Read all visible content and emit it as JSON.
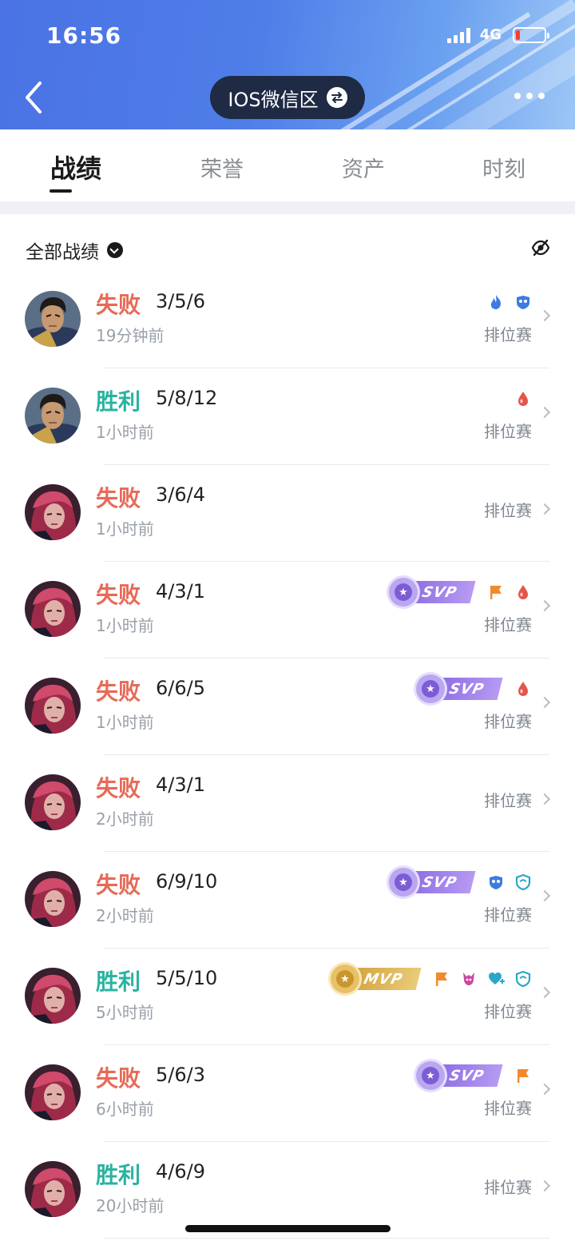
{
  "status_bar": {
    "time": "16:56",
    "network": "4G"
  },
  "header": {
    "server_label": "IOS微信区"
  },
  "tabs": [
    {
      "label": "战绩",
      "active": true
    },
    {
      "label": "荣誉",
      "active": false
    },
    {
      "label": "资产",
      "active": false
    },
    {
      "label": "时刻",
      "active": false
    }
  ],
  "filter": {
    "label": "全部战绩"
  },
  "colors": {
    "header_blue": "#4a72e4",
    "win": "#2bb3a1",
    "loss": "#e76a57",
    "svp_purple": "#8c6be2",
    "mvp_gold": "#d2a23e"
  },
  "matches": [
    {
      "result": "失败",
      "outcome": "loss",
      "kda": "3/5/6",
      "time": "19分钟前",
      "mode": "排位赛",
      "hero": "male-warrior-portrait",
      "rank_badge": null,
      "badges": [
        "flame-icon",
        "mask-icon"
      ]
    },
    {
      "result": "胜利",
      "outcome": "win",
      "kda": "5/8/12",
      "time": "1小时前",
      "mode": "排位赛",
      "hero": "male-warrior-portrait",
      "rank_badge": null,
      "badges": [
        "blood-drop-icon"
      ]
    },
    {
      "result": "失败",
      "outcome": "loss",
      "kda": "3/6/4",
      "time": "1小时前",
      "mode": "排位赛",
      "hero": "female-redhair-portrait",
      "rank_badge": null,
      "badges": []
    },
    {
      "result": "失败",
      "outcome": "loss",
      "kda": "4/3/1",
      "time": "1小时前",
      "mode": "排位赛",
      "hero": "female-redhair-portrait",
      "rank_badge": "SVP",
      "badges": [
        "flag-icon",
        "blood-drop-icon"
      ]
    },
    {
      "result": "失败",
      "outcome": "loss",
      "kda": "6/6/5",
      "time": "1小时前",
      "mode": "排位赛",
      "hero": "female-redhair-portrait",
      "rank_badge": "SVP",
      "badges": [
        "blood-drop-icon"
      ]
    },
    {
      "result": "失败",
      "outcome": "loss",
      "kda": "4/3/1",
      "time": "2小时前",
      "mode": "排位赛",
      "hero": "female-redhair-portrait",
      "rank_badge": null,
      "badges": []
    },
    {
      "result": "失败",
      "outcome": "loss",
      "kda": "6/9/10",
      "time": "2小时前",
      "mode": "排位赛",
      "hero": "female-redhair-portrait",
      "rank_badge": "SVP",
      "badges": [
        "mask-icon",
        "shield-icon"
      ]
    },
    {
      "result": "胜利",
      "outcome": "win",
      "kda": "5/5/10",
      "time": "5小时前",
      "mode": "排位赛",
      "hero": "female-redhair-portrait",
      "rank_badge": "MVP",
      "badges": [
        "flag-icon",
        "demon-icon",
        "heart-plus-icon",
        "shield-icon"
      ]
    },
    {
      "result": "失败",
      "outcome": "loss",
      "kda": "5/6/3",
      "time": "6小时前",
      "mode": "排位赛",
      "hero": "female-redhair-portrait",
      "rank_badge": "SVP",
      "badges": [
        "flag-icon"
      ]
    },
    {
      "result": "胜利",
      "outcome": "win",
      "kda": "4/6/9",
      "time": "20小时前",
      "mode": "排位赛",
      "hero": "female-redhair-portrait",
      "rank_badge": null,
      "badges": []
    }
  ]
}
